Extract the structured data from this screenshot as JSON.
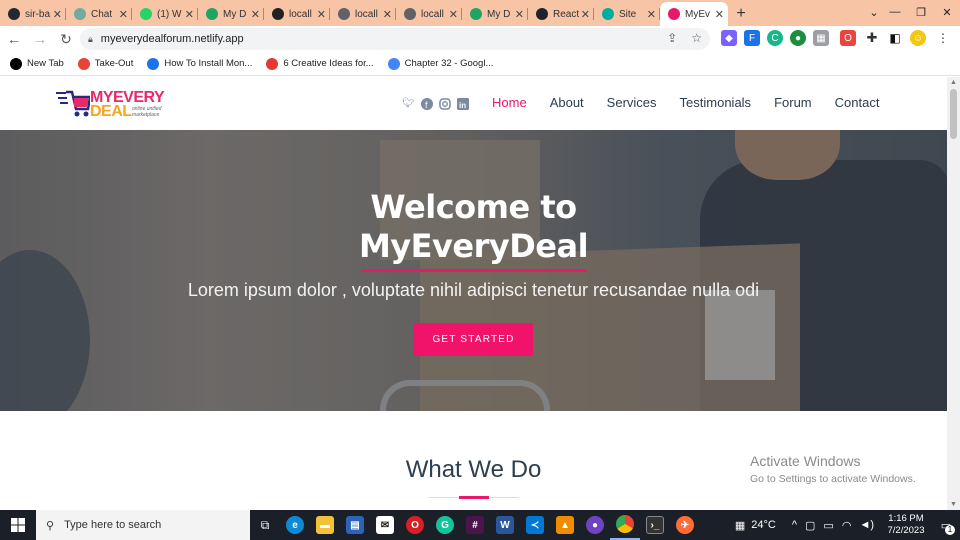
{
  "browser": {
    "tabs": [
      {
        "title": "sir-ba",
        "color": "#24292f"
      },
      {
        "title": "Chat",
        "color": "#74aa9c"
      },
      {
        "title": "(1) W",
        "color": "#25d366"
      },
      {
        "title": "My D",
        "color": "#1fa463"
      },
      {
        "title": "locall",
        "color": "#222222"
      },
      {
        "title": "locall",
        "color": "#5f6368"
      },
      {
        "title": "locall",
        "color": "#5f6368"
      },
      {
        "title": "My D",
        "color": "#1fa463"
      },
      {
        "title": "React",
        "color": "#20232a"
      },
      {
        "title": "Site",
        "color": "#00ad9f"
      },
      {
        "title": "MyEv",
        "color": "#e8196b"
      }
    ],
    "url": "myeverydealforum.netlify.app",
    "bookmarks": [
      {
        "label": "New Tab",
        "color": "#000000"
      },
      {
        "label": "Take-Out",
        "color": "#ea4335"
      },
      {
        "label": "How To Install Mon...",
        "color": "#1a73e8"
      },
      {
        "label": "6 Creative Ideas for...",
        "color": "#e53935"
      },
      {
        "label": "Chapter 32 - Googl...",
        "color": "#4285f4"
      }
    ]
  },
  "site": {
    "logo": {
      "line1": "MYEVERY",
      "line2": "DEAL",
      "tagline": "online unified marketplace"
    },
    "nav": [
      {
        "label": "Home",
        "active": true
      },
      {
        "label": "About",
        "active": false
      },
      {
        "label": "Services",
        "active": false
      },
      {
        "label": "Testimonials",
        "active": false
      },
      {
        "label": "Forum",
        "active": false
      },
      {
        "label": "Contact",
        "active": false
      }
    ],
    "social": [
      "twitter-icon",
      "facebook-icon",
      "instagram-icon",
      "linkedin-icon"
    ],
    "hero": {
      "title_line1": "Welcome to",
      "title_line2": "MyEveryDeal",
      "subtitle": "Lorem ipsum dolor , voluptate nihil adipisci tenetur recusandae nulla odi",
      "cta": "GET STARTED"
    },
    "section_title": "What We Do",
    "accent_color": "#e8196b"
  },
  "watermark": {
    "line1": "Activate Windows",
    "line2": "Go to Settings to activate Windows."
  },
  "taskbar": {
    "search_placeholder": "Type here to search",
    "temperature": "24°C",
    "time": "1:16 PM",
    "date": "7/2/2023",
    "notification_count": "1"
  }
}
